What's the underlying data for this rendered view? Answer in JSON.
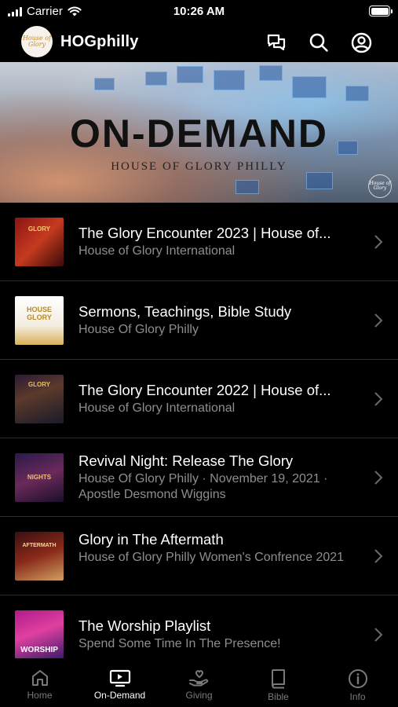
{
  "status_bar": {
    "carrier": "Carrier",
    "time": "10:26 AM"
  },
  "header": {
    "app_name": "HOGphilly",
    "logo_text": "House of Glory"
  },
  "banner": {
    "title": "ON-DEMAND",
    "subtitle": "HOUSE OF GLORY PHILLY",
    "watermark": "House of Glory"
  },
  "list": [
    {
      "title": "The Glory Encounter 2023 | House of...",
      "subtitle": "House of Glory International",
      "thumb_label": "GLORY"
    },
    {
      "title": "Sermons, Teachings, Bible Study",
      "subtitle": "House Of Glory Philly",
      "thumb_label": "HOUSE GLORY"
    },
    {
      "title": "The Glory Encounter  2022 | House of...",
      "subtitle": "House of Glory International",
      "thumb_label": "GLORY"
    },
    {
      "title": "Revival Night: Release The Glory",
      "subtitle": "House Of Glory Philly · November 19, 2021 · Apostle Desmond Wiggins",
      "thumb_label": "NIGHTS"
    },
    {
      "title": "Glory in The Aftermath",
      "subtitle": "House of Glory Philly Women's Confrence 2021",
      "thumb_label": "AFTERMATH"
    },
    {
      "title": "The Worship Playlist",
      "subtitle": "Spend Some Time In The Presence!",
      "thumb_label": "WORSHIP"
    }
  ],
  "tabs": [
    {
      "label": "Home",
      "icon": "home-icon",
      "active": false
    },
    {
      "label": "On-Demand",
      "icon": "tv-play-icon",
      "active": true
    },
    {
      "label": "Giving",
      "icon": "giving-hand-icon",
      "active": false
    },
    {
      "label": "Bible",
      "icon": "bible-book-icon",
      "active": false
    },
    {
      "label": "Info",
      "icon": "info-icon",
      "active": false
    }
  ]
}
